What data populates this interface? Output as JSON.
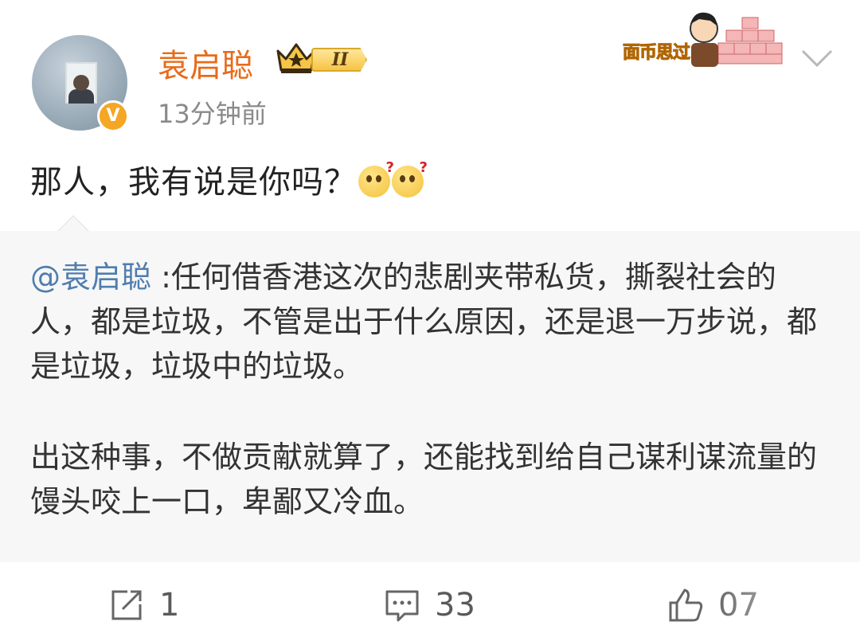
{
  "header": {
    "username": "袁启聪",
    "level_badge": "II",
    "timestamp": "13分钟前",
    "verified_mark": "V"
  },
  "sticker": {
    "text": "面币思过"
  },
  "post": {
    "text": "那人，我有说是你吗？",
    "emoji": [
      "thinking-question-emoji",
      "thinking-question-emoji"
    ]
  },
  "quote": {
    "mention": "@袁启聪",
    "text1": " :任何借香港这次的悲剧夹带私货，撕裂社会的人，都是垃圾，不管是出于什么原因，还是退一万步说，都是垃圾，垃圾中的垃圾。",
    "text2": "出这种事，不做贡献就算了，还能找到给自己谋利谋流量的馒头咬上一口，卑鄙又冷血。"
  },
  "actions": {
    "share_count": "1",
    "comment_count": "33",
    "like_count": "07"
  },
  "colors": {
    "username": "#e86b1a",
    "mention": "#507daf",
    "quote_bg": "#f7f7f7",
    "timestamp": "#8a8a8a"
  }
}
